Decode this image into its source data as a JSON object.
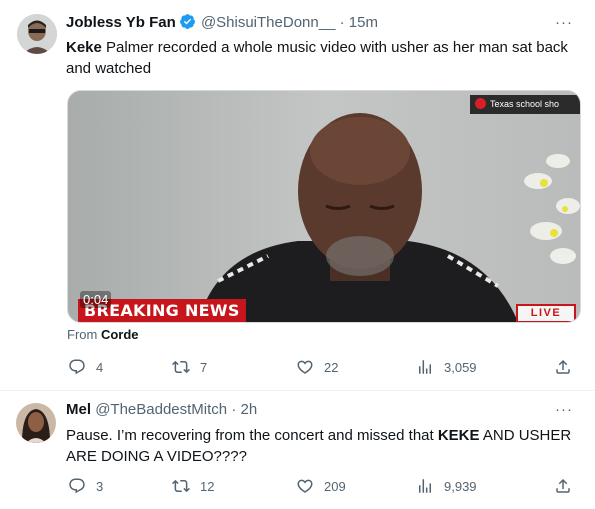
{
  "tweets": [
    {
      "author": {
        "name": "Jobless Yb Fan",
        "handle": "@ShisuiTheDonn__",
        "separator": "·",
        "time": "15m",
        "verified_icon": "verified-badge-icon"
      },
      "text": {
        "bold": "Keke",
        "rest": " Palmer recorded a whole music video with usher as her man sat back and watched"
      },
      "media": {
        "ticker_top": "Texas school sho",
        "breaking": "BREAKING NEWS",
        "duration": "0:04",
        "live": "LIVE"
      },
      "from": {
        "label": "From",
        "source": "Corde"
      },
      "actions": {
        "replies": "4",
        "retweets": "7",
        "likes": "22",
        "views": "3,059"
      },
      "more_label": "···"
    },
    {
      "author": {
        "name": "Mel",
        "handle": "@TheBaddestMitch",
        "separator": "·",
        "time": "2h"
      },
      "text": {
        "part1": "Pause. I’m recovering from the concert and missed that ",
        "bold": "KEKE",
        "part2": " AND USHER ARE DOING A VIDEO????"
      },
      "actions": {
        "replies": "3",
        "retweets": "12",
        "likes": "209",
        "views": "9,939"
      },
      "more_label": "···"
    }
  ],
  "icons": {
    "reply": "reply-icon",
    "retweet": "retweet-icon",
    "like": "heart-icon",
    "views": "views-chart-icon",
    "share": "share-icon",
    "more": "more-icon"
  },
  "colors": {
    "text": "#0f1419",
    "secondary": "#536471",
    "verified": "#1d9bf0",
    "news_red": "#c6151b",
    "divider": "#eff3f4"
  }
}
